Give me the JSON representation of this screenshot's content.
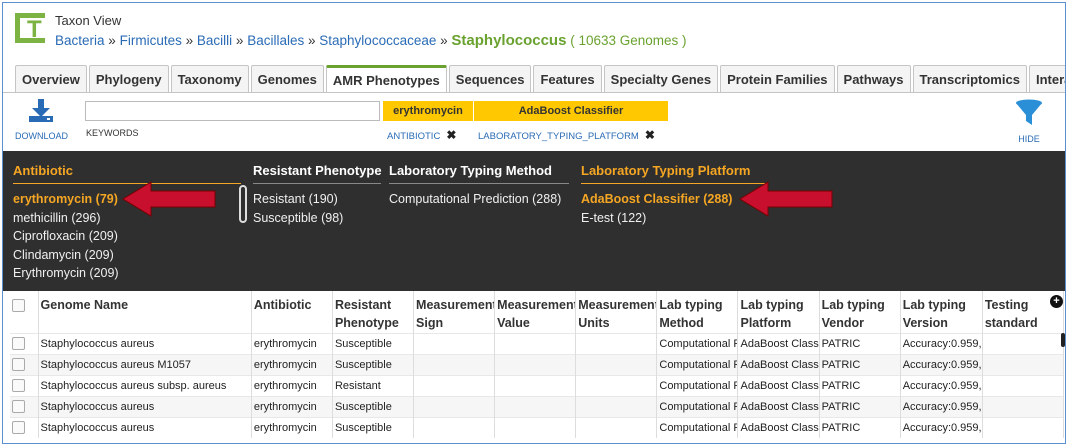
{
  "header": {
    "view_title": "Taxon View",
    "logo_letter": "T",
    "breadcrumb": [
      "Bacteria",
      "Firmicutes",
      "Bacilli",
      "Bacillales",
      "Staphylococcaceae"
    ],
    "separator": "»",
    "current": "Staphylococcus",
    "genome_count": "( 10633 Genomes )"
  },
  "tabs": [
    "Overview",
    "Phylogeny",
    "Taxonomy",
    "Genomes",
    "AMR Phenotypes",
    "Sequences",
    "Features",
    "Specialty Genes",
    "Protein Families",
    "Pathways",
    "Transcriptomics",
    "Interaction"
  ],
  "active_tab": "AMR Phenotypes",
  "toolbar": {
    "download_label": "DOWNLOAD",
    "keywords_value": "",
    "keywords_label": "KEYWORDS",
    "filters": [
      {
        "value": "erythromycin",
        "field": "ANTIBIOTIC"
      },
      {
        "value": "AdaBoost Classifier",
        "field": "LABORATORY_TYPING_PLATFORM"
      }
    ],
    "remove_icon": "✖",
    "hide_label": "HIDE"
  },
  "facets": {
    "antibiotic": {
      "title": "Antibiotic",
      "items": [
        "erythromycin (79)",
        "methicillin (296)",
        "Ciprofloxacin (209)",
        "Clindamycin (209)",
        "Erythromycin (209)"
      ]
    },
    "resistant_phenotype": {
      "title": "Resistant Phenotype",
      "items": [
        "Resistant (190)",
        "Susceptible (98)"
      ]
    },
    "lab_typing_method": {
      "title": "Laboratory Typing Method",
      "items": [
        "Computational Prediction (288)"
      ]
    },
    "lab_typing_platform": {
      "title": "Laboratory Typing Platform",
      "items": [
        "AdaBoost Classifier (288)",
        "E-test (122)"
      ]
    }
  },
  "table": {
    "columns": [
      "Genome Name",
      "Antibiotic",
      "Resistant Phenotype",
      "Measurement Sign",
      "Measurement Value",
      "Measurement Units",
      "Lab typing Method",
      "Lab typing Platform",
      "Lab typing Vendor",
      "Lab typing Version",
      "Testing standard"
    ],
    "rows": [
      [
        "Staphylococcus aureus",
        "erythromycin",
        "Susceptible",
        "",
        "",
        "",
        "Computational P",
        "AdaBoost Classi",
        "PATRIC",
        "Accuracy:0.959,",
        ""
      ],
      [
        "Staphylococcus aureus M1057",
        "erythromycin",
        "Susceptible",
        "",
        "",
        "",
        "Computational P",
        "AdaBoost Classi",
        "PATRIC",
        "Accuracy:0.959,",
        ""
      ],
      [
        "Staphylococcus aureus subsp. aureus",
        "erythromycin",
        "Resistant",
        "",
        "",
        "",
        "Computational P",
        "AdaBoost Classi",
        "PATRIC",
        "Accuracy:0.959,",
        ""
      ],
      [
        "Staphylococcus aureus",
        "erythromycin",
        "Susceptible",
        "",
        "",
        "",
        "Computational P",
        "AdaBoost Classi",
        "PATRIC",
        "Accuracy:0.959,",
        ""
      ],
      [
        "Staphylococcus aureus",
        "erythromycin",
        "Susceptible",
        "",
        "",
        "",
        "Computational P",
        "AdaBoost Classi",
        "PATRIC",
        "Accuracy:0.959,",
        ""
      ]
    ]
  },
  "colors": {
    "brand_green": "#6aa22f",
    "link_blue": "#2a6bb5",
    "chip_yellow": "#ffc800",
    "facet_bg": "#2f2f2f",
    "facet_selected": "#f5a623",
    "arrow_red": "#c8102e"
  }
}
